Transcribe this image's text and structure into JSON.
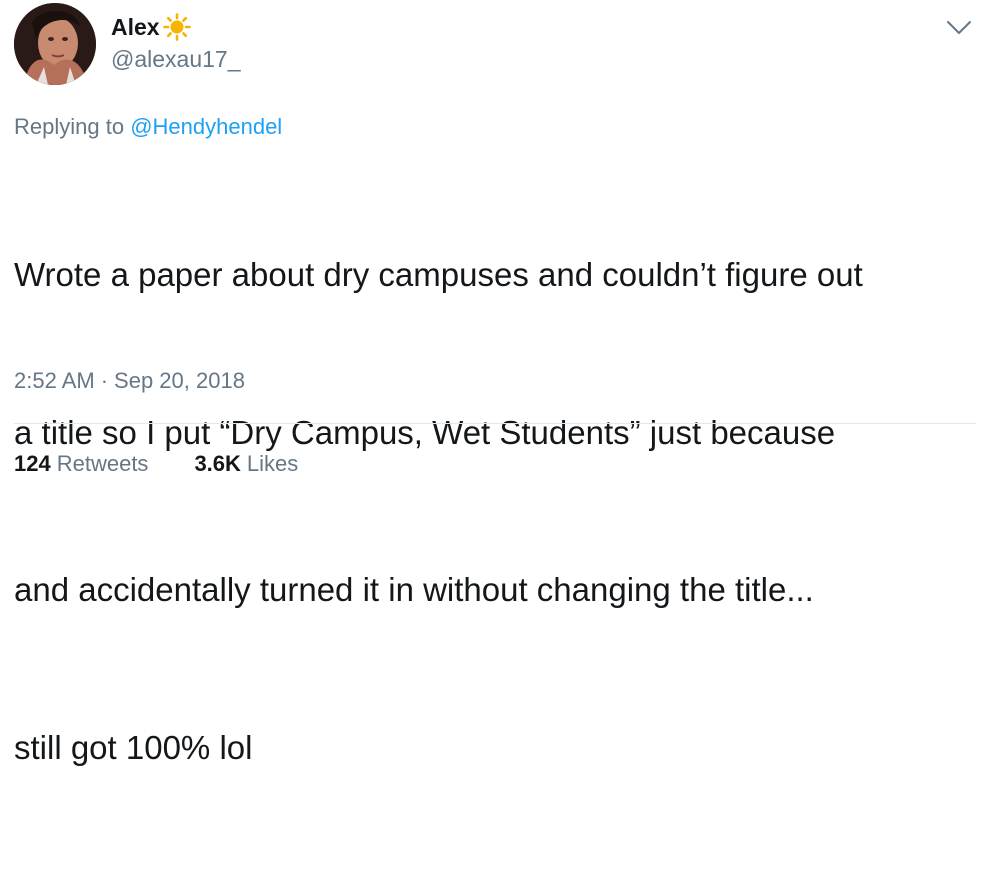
{
  "author": {
    "display_name": "Alex",
    "handle": "@alexau17_",
    "avatar_icon": "avatar-photo",
    "name_emoji_icon": "sun-icon"
  },
  "menu": {
    "icon": "chevron-down-icon"
  },
  "reply": {
    "prefix": "Replying to",
    "target": "@Hendyhendel"
  },
  "tweet": {
    "lines": [
      "Wrote a paper about dry campuses and couldn’t figure out",
      "a title so I put “Dry Campus, Wet Students” just because",
      "and accidentally turned it in without changing the title...",
      "still got 100% lol"
    ]
  },
  "meta": {
    "time": "2:52 AM",
    "separator": "·",
    "date": "Sep 20, 2018"
  },
  "stats": {
    "retweets_count": "124",
    "retweets_label": "Retweets",
    "likes_count": "3.6K",
    "likes_label": "Likes"
  },
  "colors": {
    "text": "#14171a",
    "secondary": "#657786",
    "link": "#1da1f2",
    "divider": "#e1e8ed",
    "sun": "#f5b400"
  }
}
